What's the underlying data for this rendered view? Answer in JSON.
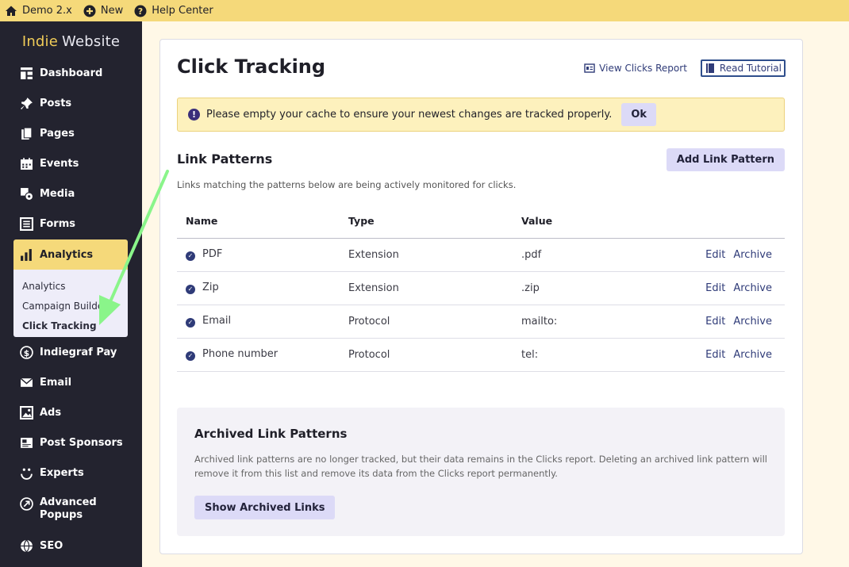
{
  "topbar": {
    "site_label": "Demo 2.x",
    "new_label": "New",
    "help_label": "Help Center"
  },
  "sidebar": {
    "brand_part1": "Indie",
    "brand_part2": "Website",
    "items": [
      {
        "label": "Dashboard",
        "icon": "dashboard-icon"
      },
      {
        "label": "Posts",
        "icon": "pin-icon"
      },
      {
        "label": "Pages",
        "icon": "pages-icon"
      },
      {
        "label": "Events",
        "icon": "calendar-icon"
      },
      {
        "label": "Media",
        "icon": "media-icon"
      },
      {
        "label": "Forms",
        "icon": "forms-icon"
      },
      {
        "label": "Analytics",
        "icon": "bar-chart-icon"
      },
      {
        "label": "Indiegraf Pay",
        "icon": "dollar-icon"
      },
      {
        "label": "Email",
        "icon": "mail-icon"
      },
      {
        "label": "Ads",
        "icon": "ads-icon"
      },
      {
        "label": "Post Sponsors",
        "icon": "sponsor-icon"
      },
      {
        "label": "Experts",
        "icon": "experts-icon"
      },
      {
        "label": "Advanced Popups",
        "icon": "popup-icon"
      },
      {
        "label": "SEO",
        "icon": "seo-icon"
      }
    ],
    "analytics_sub": [
      {
        "label": "Analytics"
      },
      {
        "label": "Campaign Builder"
      },
      {
        "label": "Click Tracking"
      }
    ]
  },
  "main": {
    "title": "Click Tracking",
    "view_report_label": "View Clicks Report",
    "read_tutorial_label": "Read Tutorial",
    "alert_text": "Please empty your cache to ensure your newest changes are tracked properly.",
    "alert_ok": "Ok",
    "section_title": "Link Patterns",
    "add_button": "Add Link Pattern",
    "section_desc": "Links matching the patterns below are being actively monitored for clicks.",
    "columns": {
      "name": "Name",
      "type": "Type",
      "value": "Value"
    },
    "rows": [
      {
        "name": "PDF",
        "type": "Extension",
        "value": ".pdf"
      },
      {
        "name": "Zip",
        "type": "Extension",
        "value": ".zip"
      },
      {
        "name": "Email",
        "type": "Protocol",
        "value": "mailto:"
      },
      {
        "name": "Phone number",
        "type": "Protocol",
        "value": "tel:"
      }
    ],
    "edit_label": "Edit",
    "archive_label": "Archive",
    "archived_title": "Archived Link Patterns",
    "archived_desc": "Archived link patterns are no longer tracked, but their data remains in the Clicks report. Deleting an archived link pattern will remove it from this list and remove its data from the Clicks report permanently.",
    "show_archived": "Show Archived Links"
  },
  "colors": {
    "topbar": "#f5d97a",
    "sidebar": "#23232f",
    "accent_button": "#dcdaf7",
    "alert_bg": "#fdf1bd",
    "annotation_arrow": "#8af58a"
  }
}
